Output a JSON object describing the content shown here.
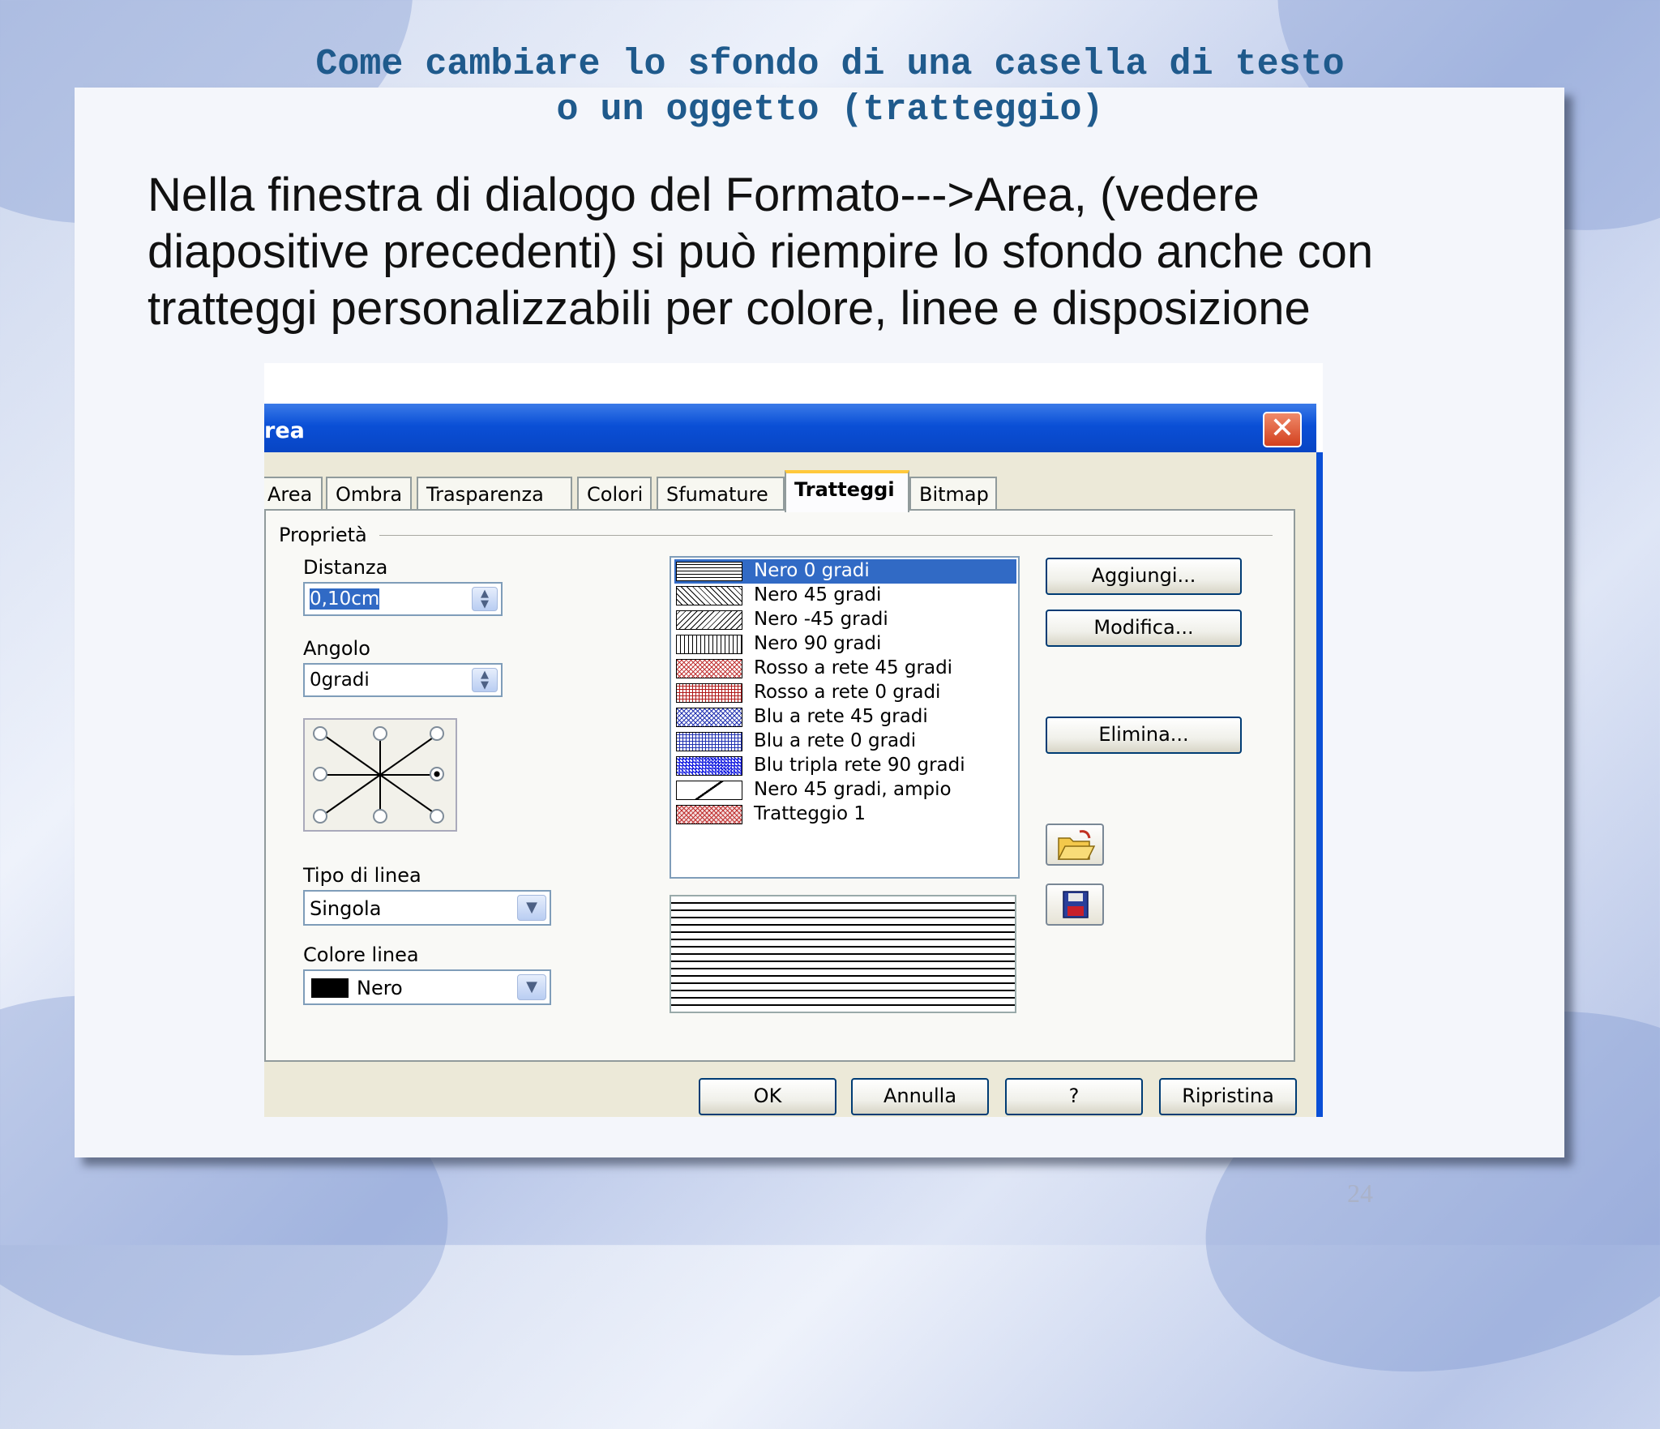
{
  "slide": {
    "title_line1": "Come cambiare lo sfondo di una casella di testo",
    "title_line2": "o un oggetto (tratteggio)",
    "body_line1": "Nella finestra di dialogo del Formato--->Area, (vedere",
    "body_line2": "diapositive precedenti) si può riempire lo sfondo anche con",
    "body_line3": "tratteggi personalizzabili per colore, linee e disposizione",
    "page_number": "24"
  },
  "dialog": {
    "title": "rea",
    "tabs": [
      "Area",
      "Ombra",
      "Trasparenza",
      "Colori",
      "Sfumature",
      "Tratteggi",
      "Bitmap"
    ],
    "active_tab": "Tratteggi",
    "group_label": "Proprietà",
    "distanza": {
      "label": "Distanza",
      "value": "0,10cm"
    },
    "angolo": {
      "label": "Angolo",
      "value": "0gradi"
    },
    "tipo_linea": {
      "label": "Tipo di linea",
      "value": "Singola"
    },
    "colore_linea": {
      "label": "Colore linea",
      "value": "Nero"
    },
    "hatch_list": [
      {
        "label": "Nero 0 gradi",
        "selected": true
      },
      {
        "label": "Nero 45 gradi"
      },
      {
        "label": "Nero -45 gradi"
      },
      {
        "label": "Nero 90 gradi"
      },
      {
        "label": "Rosso a rete 45 gradi"
      },
      {
        "label": "Rosso a rete 0 gradi"
      },
      {
        "label": "Blu a rete 45 gradi"
      },
      {
        "label": "Blu a rete 0 gradi"
      },
      {
        "label": "Blu tripla rete 90 gradi"
      },
      {
        "label": "Nero 45 gradi, ampio"
      },
      {
        "label": "Tratteggio 1"
      }
    ],
    "buttons": {
      "aggiungi": "Aggiungi...",
      "modifica": "Modifica...",
      "elimina": "Elimina...",
      "ok": "OK",
      "annulla": "Annulla",
      "help": "?",
      "ripristina": "Ripristina"
    },
    "icons": {
      "close": "close-icon",
      "open": "open-folder-icon",
      "save": "save-disk-icon"
    },
    "colors": {
      "titlebar": "#0a4fd6",
      "selection": "#316ac5",
      "close": "#d2401e"
    }
  }
}
